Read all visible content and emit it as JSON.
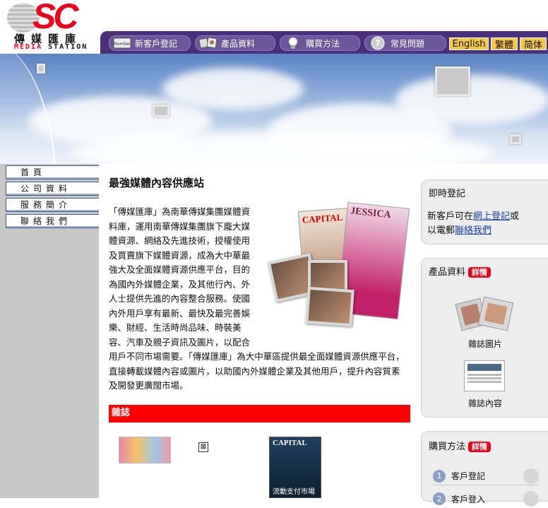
{
  "header": {
    "logo": {
      "mark": "SC",
      "chinese": "傳媒匯庫",
      "english_red": "MEDIA",
      "english_black": "STATION"
    },
    "nav": [
      {
        "label": "新客戶登記",
        "icon": "member-card-icon"
      },
      {
        "label": "產品資料",
        "icon": "photo-frames-icon"
      },
      {
        "label": "購買方法",
        "icon": "lightbulb-icon"
      },
      {
        "label": "常見問題",
        "icon": "question-icon"
      }
    ],
    "lang": {
      "english": "English",
      "traditional": "繁體",
      "simplified": "简体"
    }
  },
  "leftnav": [
    "首頁",
    "公司資料",
    "服務簡介",
    "聯絡我們"
  ],
  "main": {
    "title": "最強媒體內容供應站",
    "intro": "「傳媒匯庫」為南華傳媒集團媒體資料庫，運用南華傳媒集團旗下龐大媒體資源、網絡及先進技術，授權使用及買賣旗下媒體資源，成為大中華最強大及全面媒體資源供應平台，目的為國內外媒體企業，及其他行內、外人士提供先進的內容整合服務。使國內外用戶享有最新、最快及最完善娛樂、財經、生活時尚品味、時裝美容、汽車及親子資訊及圖片，以配合用戶不同市場需要。「傳媒匯庫」為大中華區提供最全面媒體資源供應平台，直接轉載媒體內容或圖片，以助國內外媒體企業及其他用戶，提升內容質素及開發更廣闊市場。",
    "section_title": "雜誌",
    "magazine_covers": [
      "CAPITAL",
      "JESSICA"
    ],
    "cover_caption": "流動支付市場"
  },
  "sidebar": {
    "register": {
      "title": "即時登記",
      "line1_prefix": "新客戶可在",
      "line1_link": "網上登記",
      "line1_suffix": "或",
      "line2_prefix": "以電郵",
      "line2_link": "聯絡我們"
    },
    "products": {
      "title": "產品資料",
      "tag": "詳情",
      "items": [
        {
          "label": "雜誌圖片",
          "icon": "photo-frames-icon"
        },
        {
          "label": "雜誌內容",
          "icon": "magazine-page-icon"
        }
      ]
    },
    "purchase": {
      "title": "購買方法",
      "tag": "詳情",
      "steps": [
        {
          "num": "1",
          "label": "客戶登記"
        },
        {
          "num": "2",
          "label": "客戶登入"
        }
      ]
    }
  },
  "colors": {
    "brand_red": "#e8001c",
    "nav_purple": "#4a2f7a",
    "lang_yellow": "#f7c74a",
    "section_red": "#ff0000"
  }
}
